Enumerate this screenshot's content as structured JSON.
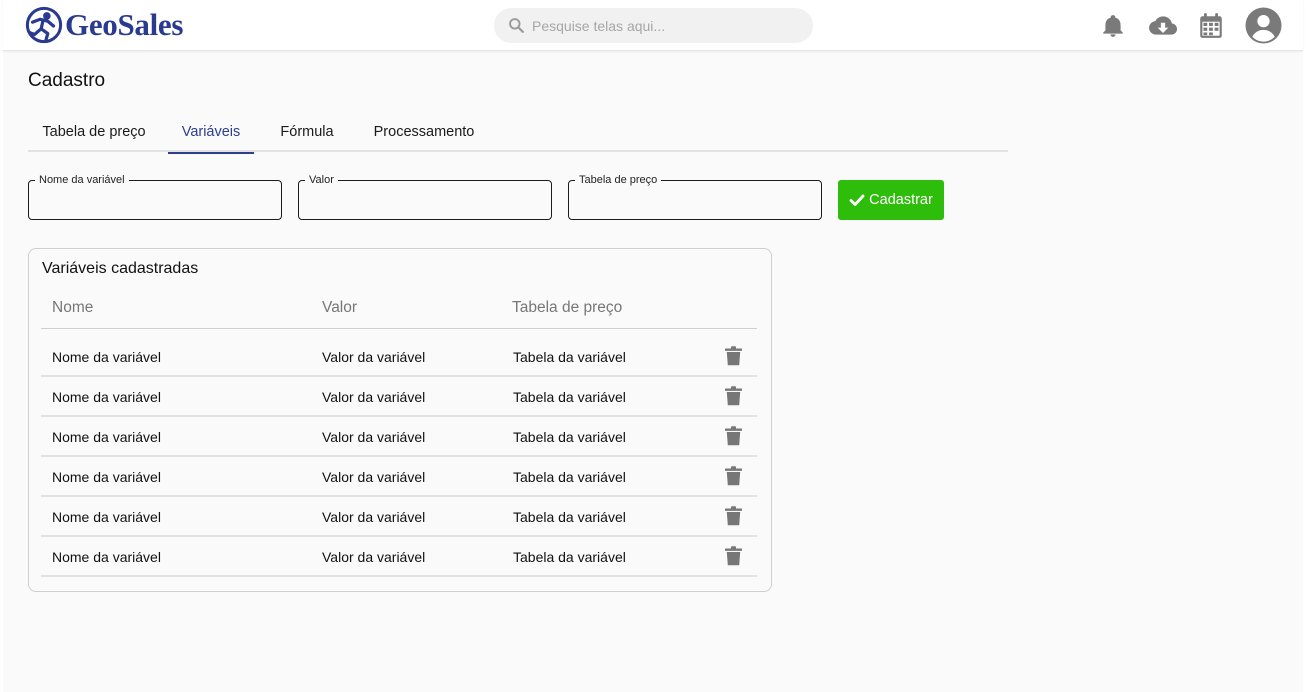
{
  "header": {
    "brand": "GeoSales",
    "brand_color": "#2a3b8f",
    "search_placeholder": "Pesquise telas aqui...",
    "icons": [
      "bell-icon",
      "cloud-download-icon",
      "calendar-icon",
      "user-avatar-icon"
    ]
  },
  "page": {
    "title": "Cadastro"
  },
  "tabs": [
    {
      "label": "Tabela de preço",
      "active": false
    },
    {
      "label": "Variáveis",
      "active": true
    },
    {
      "label": "Fórmula",
      "active": false
    },
    {
      "label": "Processamento",
      "active": false
    }
  ],
  "accent_color": "#2d3e8e",
  "form": {
    "fields": [
      {
        "label": "Nome da variável",
        "value": ""
      },
      {
        "label": "Valor",
        "value": ""
      },
      {
        "label": "Tabela de preço",
        "value": ""
      }
    ],
    "submit_label": "Cadastrar",
    "submit_color": "#2fbd0c"
  },
  "table": {
    "title": "Variáveis cadastradas",
    "columns": [
      "Nome",
      "Valor",
      "Tabela de preço"
    ],
    "rows": [
      {
        "nome": "Nome da variável",
        "valor": "Valor da variável",
        "tabela": "Tabela da variável"
      },
      {
        "nome": "Nome da variável",
        "valor": "Valor da variável",
        "tabela": "Tabela da variável"
      },
      {
        "nome": "Nome da variável",
        "valor": "Valor da variável",
        "tabela": "Tabela da variável"
      },
      {
        "nome": "Nome da variável",
        "valor": "Valor da variável",
        "tabela": "Tabela da variável"
      },
      {
        "nome": "Nome da variável",
        "valor": "Valor da variável",
        "tabela": "Tabela da variável"
      },
      {
        "nome": "Nome da variável",
        "valor": "Valor da variável",
        "tabela": "Tabela da variável"
      }
    ],
    "row_action_icon": "trash-icon"
  }
}
